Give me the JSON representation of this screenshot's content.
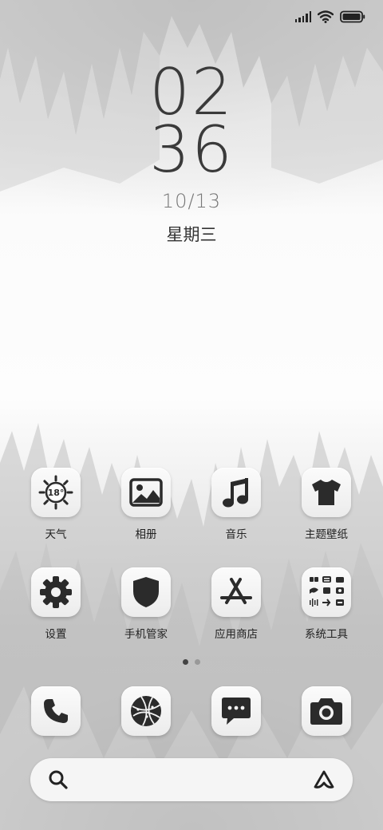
{
  "status_bar": {
    "signal_icon": "cellular-signal-icon",
    "wifi_icon": "wifi-icon",
    "battery_icon": "battery-icon"
  },
  "clock": {
    "hours": "02",
    "minutes": "36",
    "date": "10/13",
    "weekday": "星期三"
  },
  "apps": [
    {
      "label": "天气",
      "icon": "weather-sun-icon",
      "badge": "18°"
    },
    {
      "label": "相册",
      "icon": "gallery-icon"
    },
    {
      "label": "音乐",
      "icon": "music-note-icon"
    },
    {
      "label": "主题壁纸",
      "icon": "theme-shirt-icon"
    },
    {
      "label": "设置",
      "icon": "gear-icon"
    },
    {
      "label": "手机管家",
      "icon": "shield-icon"
    },
    {
      "label": "应用商店",
      "icon": "app-store-icon"
    },
    {
      "label": "系统工具",
      "icon": "folder-grid-icon"
    }
  ],
  "page_indicator": {
    "pages": 2,
    "active": 1
  },
  "dock": [
    {
      "name": "phone",
      "icon": "phone-icon"
    },
    {
      "name": "browser",
      "icon": "globe-icon"
    },
    {
      "name": "messages",
      "icon": "message-icon"
    },
    {
      "name": "camera",
      "icon": "camera-icon"
    }
  ],
  "search_bar": {
    "search_icon": "search-icon",
    "assistant_icon": "assistant-icon"
  },
  "colors": {
    "icon": "#2b2b2b",
    "tile": "#f2f2f2",
    "text": "#222222"
  }
}
